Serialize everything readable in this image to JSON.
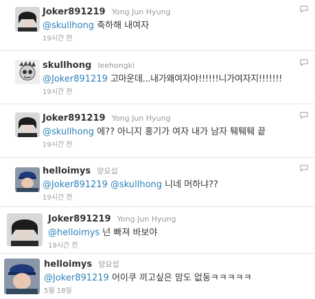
{
  "tweets": [
    {
      "screen_name": "Joker891219",
      "full_name": "Yong Jun Hyung",
      "mention": "@skullhong",
      "mention2": "",
      "text": "축하해 내여자",
      "time": "19시간 전",
      "avatar": "avatar-joker-icon"
    },
    {
      "screen_name": "skullhong",
      "full_name": "leehongki",
      "mention": "@Joker891219",
      "mention2": "",
      "text": "고마운데...내가왜여자야!!!!!!니가여자지!!!!!!!",
      "time": "19시간 전",
      "avatar": "avatar-skullhong-icon"
    },
    {
      "screen_name": "Joker891219",
      "full_name": "Yong Jun Hyung",
      "mention": "@skullhong",
      "mention2": "",
      "text": "에?? 아니지 홍기가 여자 내가 남자 퉤퉤퉤 끝",
      "time": "19시간 전",
      "avatar": "avatar-joker-icon"
    },
    {
      "screen_name": "helloimys",
      "full_name": "양요섭",
      "mention": "@Joker891219",
      "mention2": "@skullhong",
      "text": "니네 머하냐??",
      "time": "19시간 전",
      "avatar": "avatar-helloimys-icon"
    },
    {
      "screen_name": "Joker891219",
      "full_name": "Yong Jun Hyung",
      "mention": "@helloimys",
      "mention2": "",
      "text": "넌 빠져 바보야",
      "time": "19시간 전",
      "avatar": "avatar-joker-icon"
    },
    {
      "screen_name": "helloimys",
      "full_name": "양요섭",
      "mention": "@Joker891219",
      "mention2": "",
      "text": "어이쿠 끼고싶은 맘도 없둥ㅋㅋㅋㅋㅋ",
      "time": "5월 18일",
      "avatar": "avatar-helloimys-icon"
    }
  ],
  "colors": {
    "mention": "#2a80b9",
    "name": "#333333",
    "meta": "#999999",
    "divider": "#e6e6e6"
  },
  "icons": {
    "reply": "speech-bubble-icon"
  }
}
